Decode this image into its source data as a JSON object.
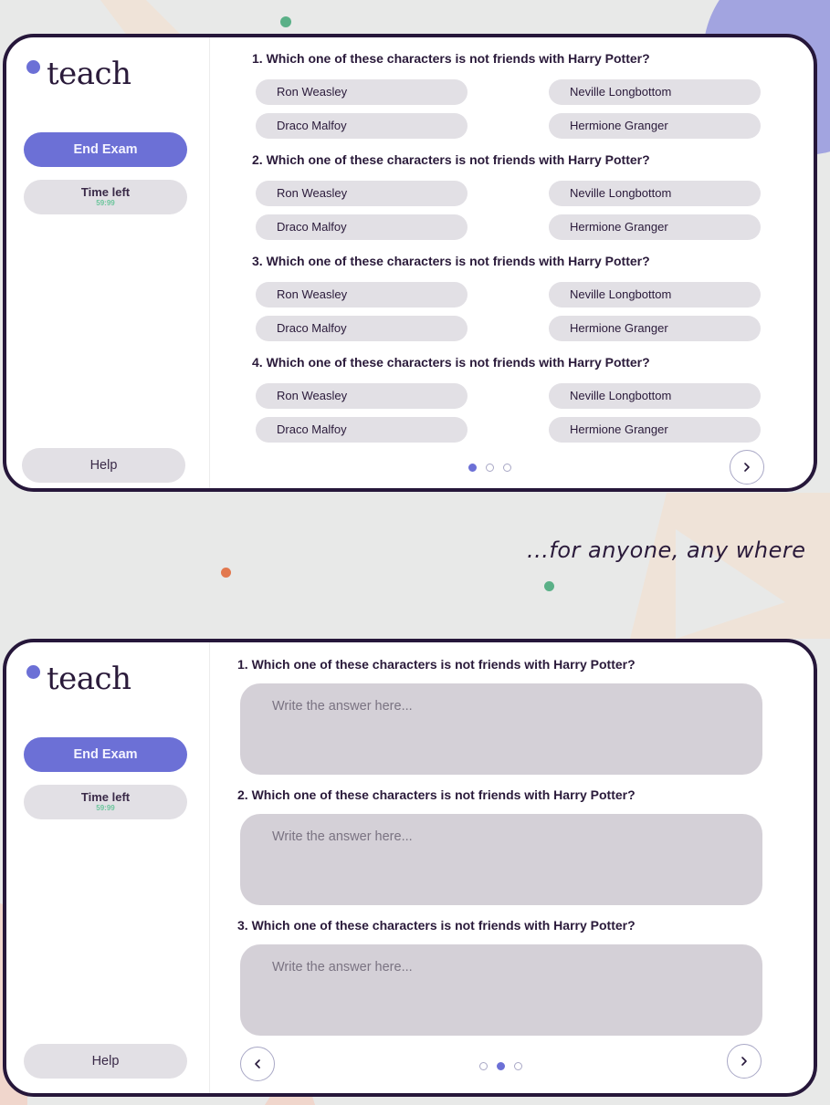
{
  "colors": {
    "accent": "#6c70d6",
    "frame_border": "#26173a",
    "option_bg": "#e2e0e5",
    "answer_bg": "#d4d0d7",
    "timer_text": "#6cc59c",
    "background": "#e8e9e8"
  },
  "screen1": {
    "logo": {
      "text": "teach"
    },
    "sidebar": {
      "end_exam_label": "End Exam",
      "time_left_label": "Time left",
      "time_left_value": "59:99",
      "help_label": "Help"
    },
    "questions": [
      {
        "title": "1. Which one of these characters is not friends with Harry Potter?",
        "options": [
          "Ron Weasley",
          "Neville Longbottom",
          "Draco Malfoy",
          "Hermione Granger"
        ]
      },
      {
        "title": "2. Which one of these characters is not friends with Harry Potter?",
        "options": [
          "Ron Weasley",
          "Neville Longbottom",
          "Draco Malfoy",
          "Hermione Granger"
        ]
      },
      {
        "title": "3. Which one of these characters is not friends with Harry Potter?",
        "options": [
          "Ron Weasley",
          "Neville Longbottom",
          "Draco Malfoy",
          "Hermione Granger"
        ]
      },
      {
        "title": "4. Which one of these characters is not friends with Harry Potter?",
        "options": [
          "Ron Weasley",
          "Neville Longbottom",
          "Draco Malfoy",
          "Hermione Granger"
        ]
      }
    ],
    "pagination": {
      "pages": 3,
      "active": 1
    },
    "icons": {
      "next": "chevron-right-icon"
    }
  },
  "tagline": "...for anyone, any where",
  "screen2": {
    "logo": {
      "text": "teach"
    },
    "sidebar": {
      "end_exam_label": "End Exam",
      "time_left_label": "Time left",
      "time_left_value": "59:99",
      "help_label": "Help"
    },
    "questions": [
      {
        "title": "1. Which one of these characters is not friends with Harry Potter?",
        "placeholder": "Write the answer here..."
      },
      {
        "title": "2. Which one of these characters is not friends with Harry Potter?",
        "placeholder": "Write the answer here..."
      },
      {
        "title": "3. Which one of these characters is not friends with Harry Potter?",
        "placeholder": "Write the answer here..."
      }
    ],
    "pagination": {
      "pages": 3,
      "active": 2
    },
    "icons": {
      "prev": "chevron-left-icon",
      "next": "chevron-right-icon"
    }
  }
}
